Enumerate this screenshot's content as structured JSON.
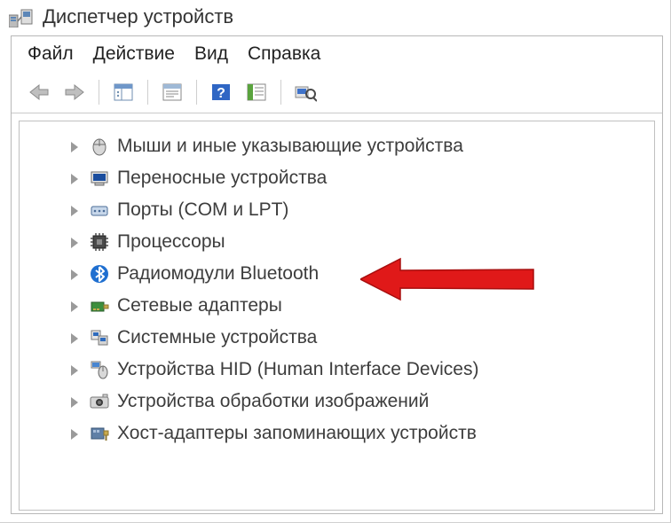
{
  "window": {
    "title": "Диспетчер устройств"
  },
  "menu": {
    "file": "Файл",
    "action": "Действие",
    "view": "Вид",
    "help": "Справка"
  },
  "toolbar": {
    "back": "back-icon",
    "forward": "forward-icon",
    "show_hidden": "show-hidden-icon",
    "properties": "properties-icon",
    "help": "help-icon",
    "details": "details-icon",
    "scan": "scan-icon"
  },
  "tree": {
    "items": [
      {
        "icon": "mouse-icon",
        "label": "Мыши и иные указывающие устройства"
      },
      {
        "icon": "portable-device-icon",
        "label": "Переносные устройства"
      },
      {
        "icon": "ports-icon",
        "label": "Порты (COM и LPT)"
      },
      {
        "icon": "cpu-icon",
        "label": "Процессоры"
      },
      {
        "icon": "bluetooth-icon",
        "label": "Радиомодули Bluetooth"
      },
      {
        "icon": "network-adapter-icon",
        "label": "Сетевые адаптеры"
      },
      {
        "icon": "system-device-icon",
        "label": "Системные устройства"
      },
      {
        "icon": "hid-icon",
        "label": "Устройства HID (Human Interface Devices)"
      },
      {
        "icon": "imaging-icon",
        "label": "Устройства обработки изображений"
      },
      {
        "icon": "storage-host-icon",
        "label": "Хост-адаптеры запоминающих устройств"
      }
    ]
  }
}
